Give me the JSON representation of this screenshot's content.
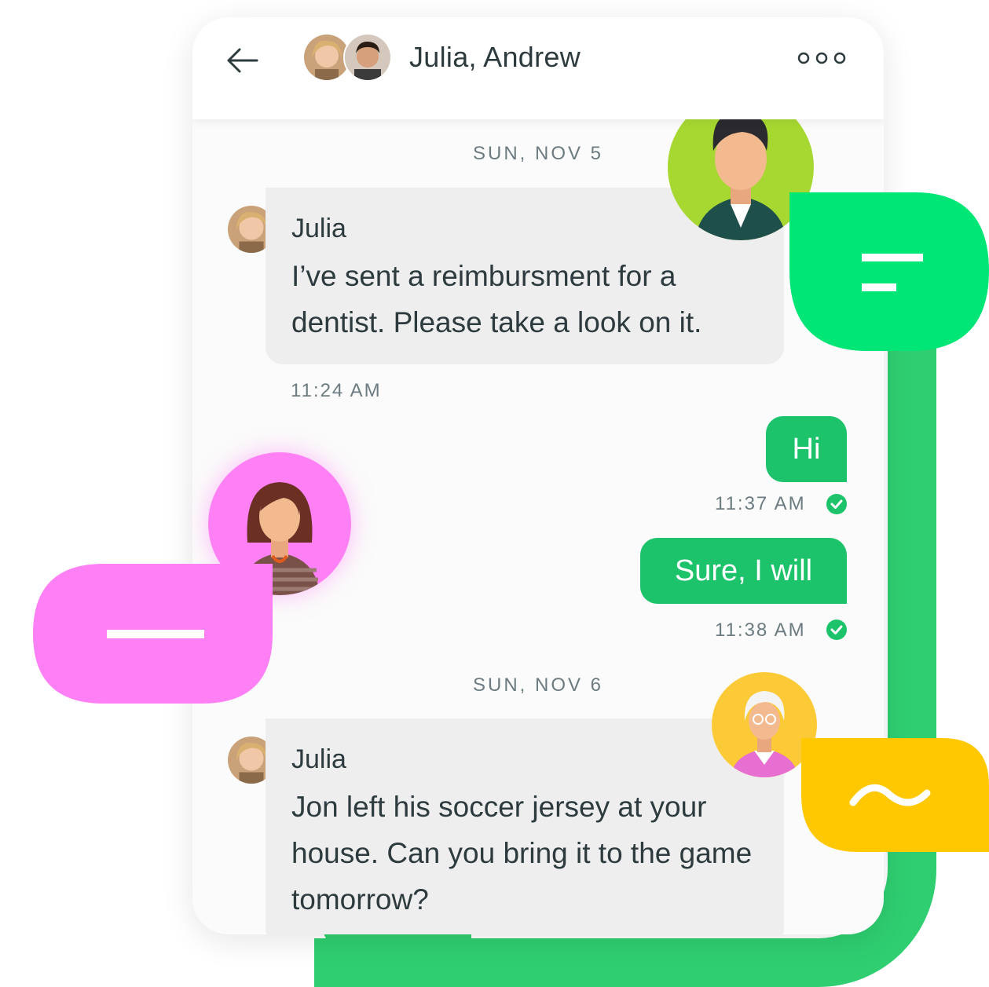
{
  "header": {
    "title": "Julia, Andrew",
    "back_icon": "arrow-left-icon",
    "more_icon": "more-horizontal-icon"
  },
  "messages": [
    {
      "type": "date",
      "text": "SUN, NOV 5"
    },
    {
      "type": "incoming",
      "sender": "Julia",
      "text": "I’ve sent a reimbursment for a dentist. Please take a look on it.",
      "time": "11:24 AM"
    },
    {
      "type": "outgoing",
      "text": "Hi",
      "time": "11:37 AM",
      "status": "delivered"
    },
    {
      "type": "outgoing",
      "text": "Sure, I will",
      "time": "11:38 AM",
      "status": "delivered"
    },
    {
      "type": "date",
      "text": "SUN, NOV 6"
    },
    {
      "type": "incoming",
      "sender": "Julia",
      "text": "Jon left his soccer jersey at your house. Can you bring it to the game tomorrow?"
    }
  ],
  "colors": {
    "accent_green": "#1dc36a",
    "track_green": "#2fce71",
    "bright_green": "#00e676",
    "pink": "#ff80f5",
    "yellow": "#ffc800"
  }
}
